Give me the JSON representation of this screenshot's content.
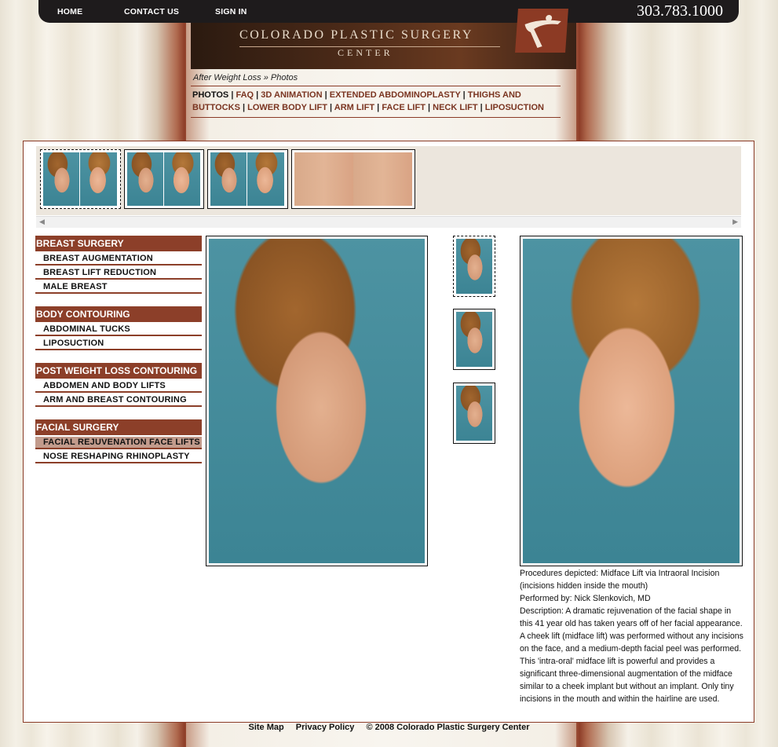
{
  "topnav": {
    "home": "HOME",
    "contact": "CONTACT US",
    "signin": "SIGN IN",
    "phone": "303.783.1000"
  },
  "brand": {
    "line1": "COLORADO PLASTIC SURGERY",
    "line2": "CENTER"
  },
  "breadcrumb": {
    "parent": "After Weight Loss",
    "separator": "»",
    "current": "Photos"
  },
  "subnav": {
    "items": [
      "PHOTOS",
      "FAQ",
      "3D ANIMATION",
      "EXTENDED ABDOMINOPLASTY",
      "THIGHS AND BUTTOCKS",
      "LOWER BODY LIFT",
      "ARM LIFT",
      "FACE LIFT",
      "NECK LIFT",
      "LIPOSUCTION"
    ],
    "separator": "|"
  },
  "sidemenu": {
    "categories": [
      {
        "title": "BREAST SURGERY",
        "items": [
          "BREAST AUGMENTATION",
          "BREAST LIFT REDUCTION",
          "MALE BREAST"
        ]
      },
      {
        "title": "BODY CONTOURING",
        "items": [
          "ABDOMINAL TUCKS",
          "LIPOSUCTION"
        ]
      },
      {
        "title": "POST WEIGHT LOSS CONTOURING",
        "items": [
          "ABDOMEN AND BODY LIFTS",
          "ARM AND BREAST CONTOURING"
        ]
      },
      {
        "title": "FACIAL SURGERY",
        "items": [
          "FACIAL REJUVENATION FACE LIFTS",
          "NOSE RESHAPING RHINOPLASTY"
        ]
      }
    ],
    "active_item": "FACIAL REJUVENATION FACE LIFTS"
  },
  "description": {
    "procedures": "Procedures depicted: Midface Lift via Intraoral Incision (incisions hidden inside the mouth)",
    "performed_by": "Performed by: Nick Slenkovich, MD",
    "text": "Description: A dramatic rejuvenation of the facial shape in this 41 year old has taken years off of her facial appearance. A cheek lift (midface lift) was performed without any incisions on the face, and a medium-depth facial peel was performed. This 'intra-oral' midface lift is powerful and provides a significant three-dimensional augmentation of the midface similar to a cheek implant but without an implant. Only tiny incisions in the mouth and within the hairline are used."
  },
  "footer": {
    "sitemap": "Site Map",
    "privacy": "Privacy Policy",
    "copyright": "© 2008 Colorado Plastic Surgery Center"
  },
  "colors": {
    "accent": "#8c3f29",
    "topbar": "#1e1b1c",
    "active_menu": "#c29b8c"
  }
}
